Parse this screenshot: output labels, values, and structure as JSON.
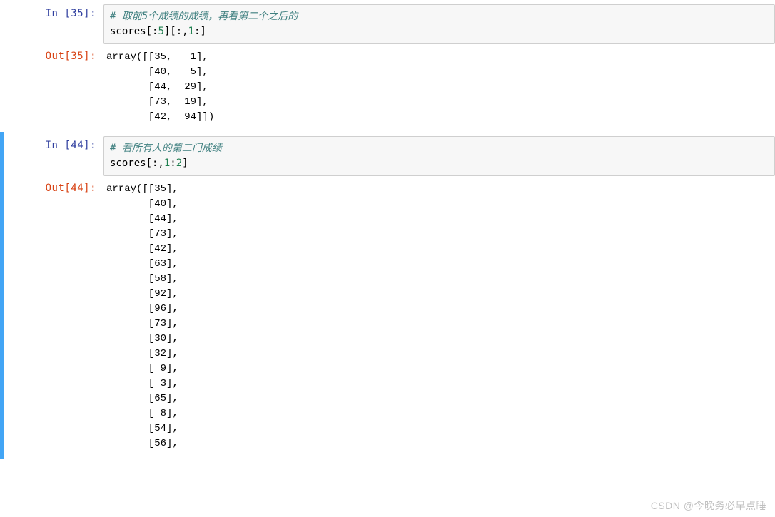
{
  "cell1": {
    "prompt_in": "In  [35]:",
    "prompt_out": "Out[35]:",
    "comment": "# 取前5个成绩的成绩，再看第二个之后的",
    "code_prefix": "scores[:",
    "num_a": "5",
    "code_mid1": "][:,",
    "num_b": "1",
    "code_tail": ":]",
    "output": "array([[35,   1],\n       [40,   5],\n       [44,  29],\n       [73,  19],\n       [42,  94]])"
  },
  "cell2": {
    "prompt_in": "In  [44]:",
    "prompt_out": "Out[44]:",
    "comment": "# 看所有人的第二门成绩",
    "code_prefix": "scores[:,",
    "num_a": "1",
    "code_mid1": ":",
    "num_b": "2",
    "code_tail": "]",
    "output": "array([[35],\n       [40],\n       [44],\n       [73],\n       [42],\n       [63],\n       [58],\n       [92],\n       [96],\n       [73],\n       [30],\n       [32],\n       [ 9],\n       [ 3],\n       [65],\n       [ 8],\n       [54],\n       [56],"
  },
  "watermark": "CSDN @今晚务必早点睡"
}
